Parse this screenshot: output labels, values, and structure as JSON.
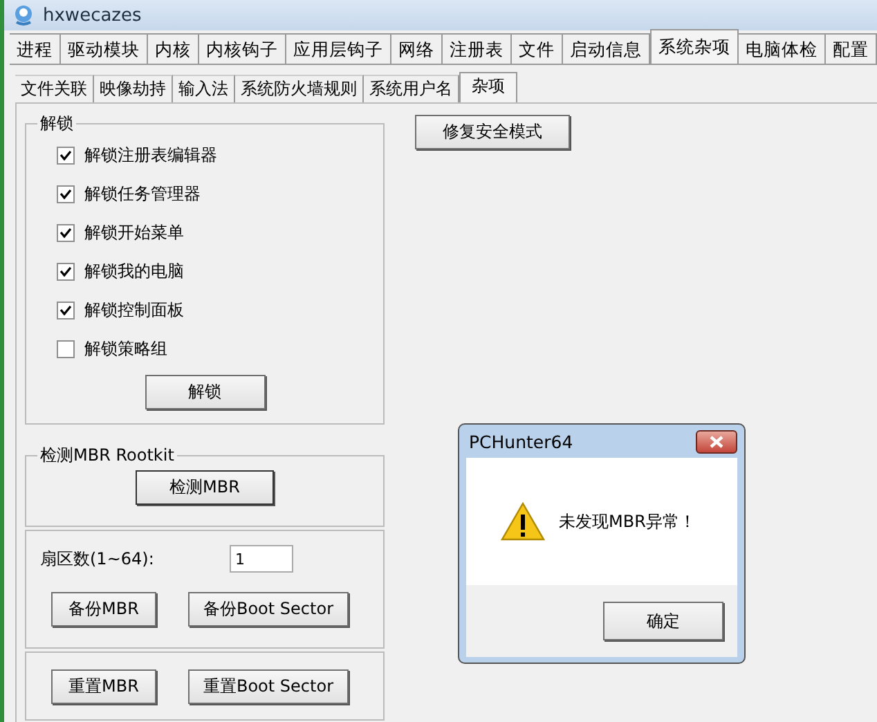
{
  "window": {
    "title": "hxwecazes"
  },
  "tabs": [
    {
      "label": "进程",
      "selected": false
    },
    {
      "label": "驱动模块",
      "selected": false
    },
    {
      "label": "内核",
      "selected": false
    },
    {
      "label": "内核钩子",
      "selected": false
    },
    {
      "label": "应用层钩子",
      "selected": false
    },
    {
      "label": "网络",
      "selected": false
    },
    {
      "label": "注册表",
      "selected": false
    },
    {
      "label": "文件",
      "selected": false
    },
    {
      "label": "启动信息",
      "selected": false
    },
    {
      "label": "系统杂项",
      "selected": true
    },
    {
      "label": "电脑体检",
      "selected": false
    },
    {
      "label": "配置",
      "selected": false
    }
  ],
  "subtabs": [
    {
      "label": "文件关联",
      "selected": false
    },
    {
      "label": "映像劫持",
      "selected": false
    },
    {
      "label": "输入法",
      "selected": false
    },
    {
      "label": "系统防火墙规则",
      "selected": false
    },
    {
      "label": "系统用户名",
      "selected": false
    },
    {
      "label": "杂项",
      "selected": true
    }
  ],
  "unlock_group": {
    "title": "解锁",
    "options": [
      {
        "label": "解锁注册表编辑器",
        "checked": true
      },
      {
        "label": "解锁任务管理器",
        "checked": true
      },
      {
        "label": "解锁开始菜单",
        "checked": true
      },
      {
        "label": "解锁我的电脑",
        "checked": true
      },
      {
        "label": "解锁控制面板",
        "checked": true
      },
      {
        "label": "解锁策略组",
        "checked": false
      }
    ],
    "button": "解锁"
  },
  "repair_button": "修复安全模式",
  "mbr_group": {
    "title": "检测MBR Rootkit",
    "button": "检测MBR"
  },
  "sector_group": {
    "label": "扇区数(1~64):",
    "value": "1",
    "buttons": [
      "备份MBR",
      "备份Boot Sector"
    ]
  },
  "reset_group": {
    "buttons": [
      "重置MBR",
      "重置Boot Sector"
    ]
  },
  "dialog": {
    "title": "PCHunter64",
    "message": "未发现MBR异常！",
    "ok_button": "确定"
  }
}
